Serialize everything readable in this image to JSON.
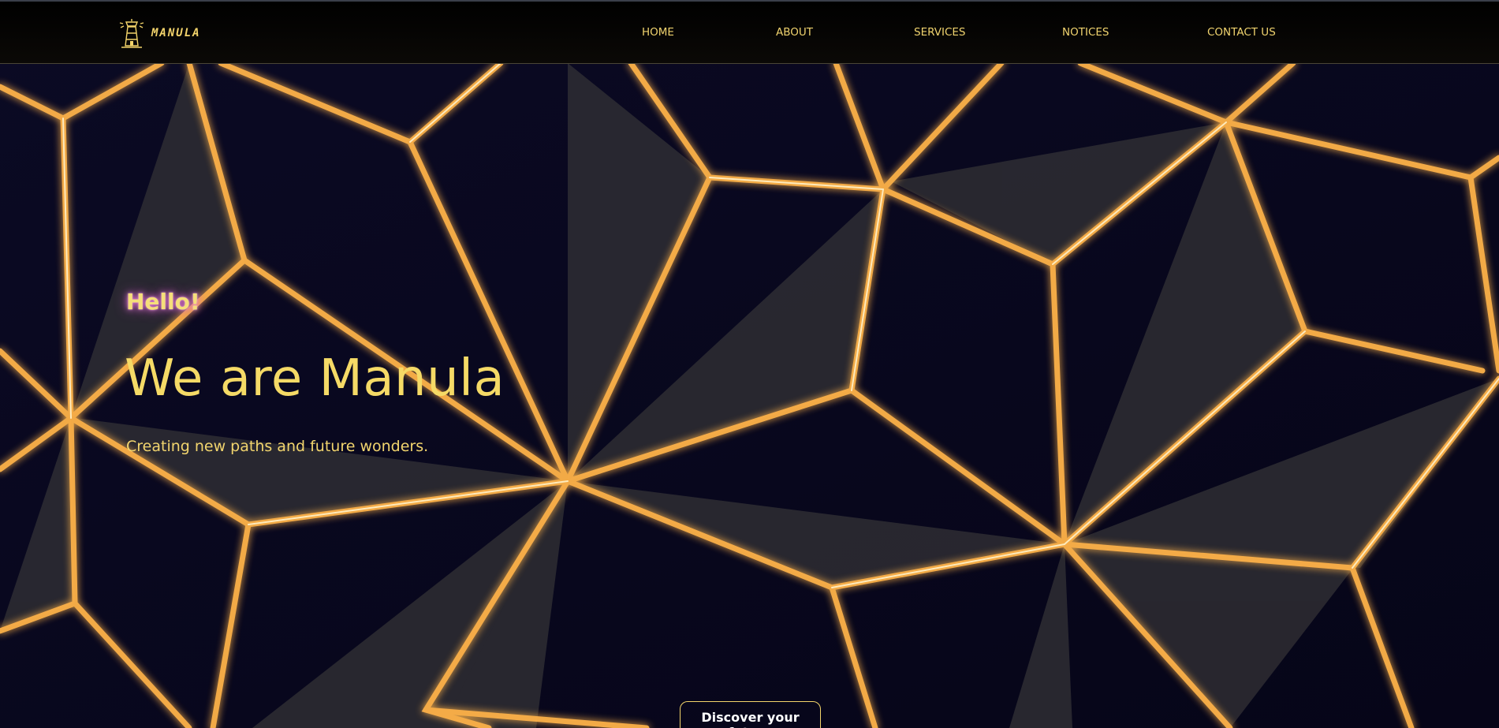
{
  "brand": {
    "name": "MANULA",
    "icon": "lighthouse-icon"
  },
  "nav": [
    {
      "label": "HOME"
    },
    {
      "label": "ABOUT"
    },
    {
      "label": "SERVICES"
    },
    {
      "label": "NOTICES"
    },
    {
      "label": "CONTACT US"
    }
  ],
  "hero": {
    "greeting": "Hello!",
    "headline": "We are Manula",
    "tagline": "Creating new paths and future wonders.",
    "cta_label": "Discover your future"
  },
  "colors": {
    "accent_gold": "#f3d46a",
    "background": "#07061a",
    "glow_orange": "#ffb34a",
    "greeting_glow": "#e77bd8"
  }
}
